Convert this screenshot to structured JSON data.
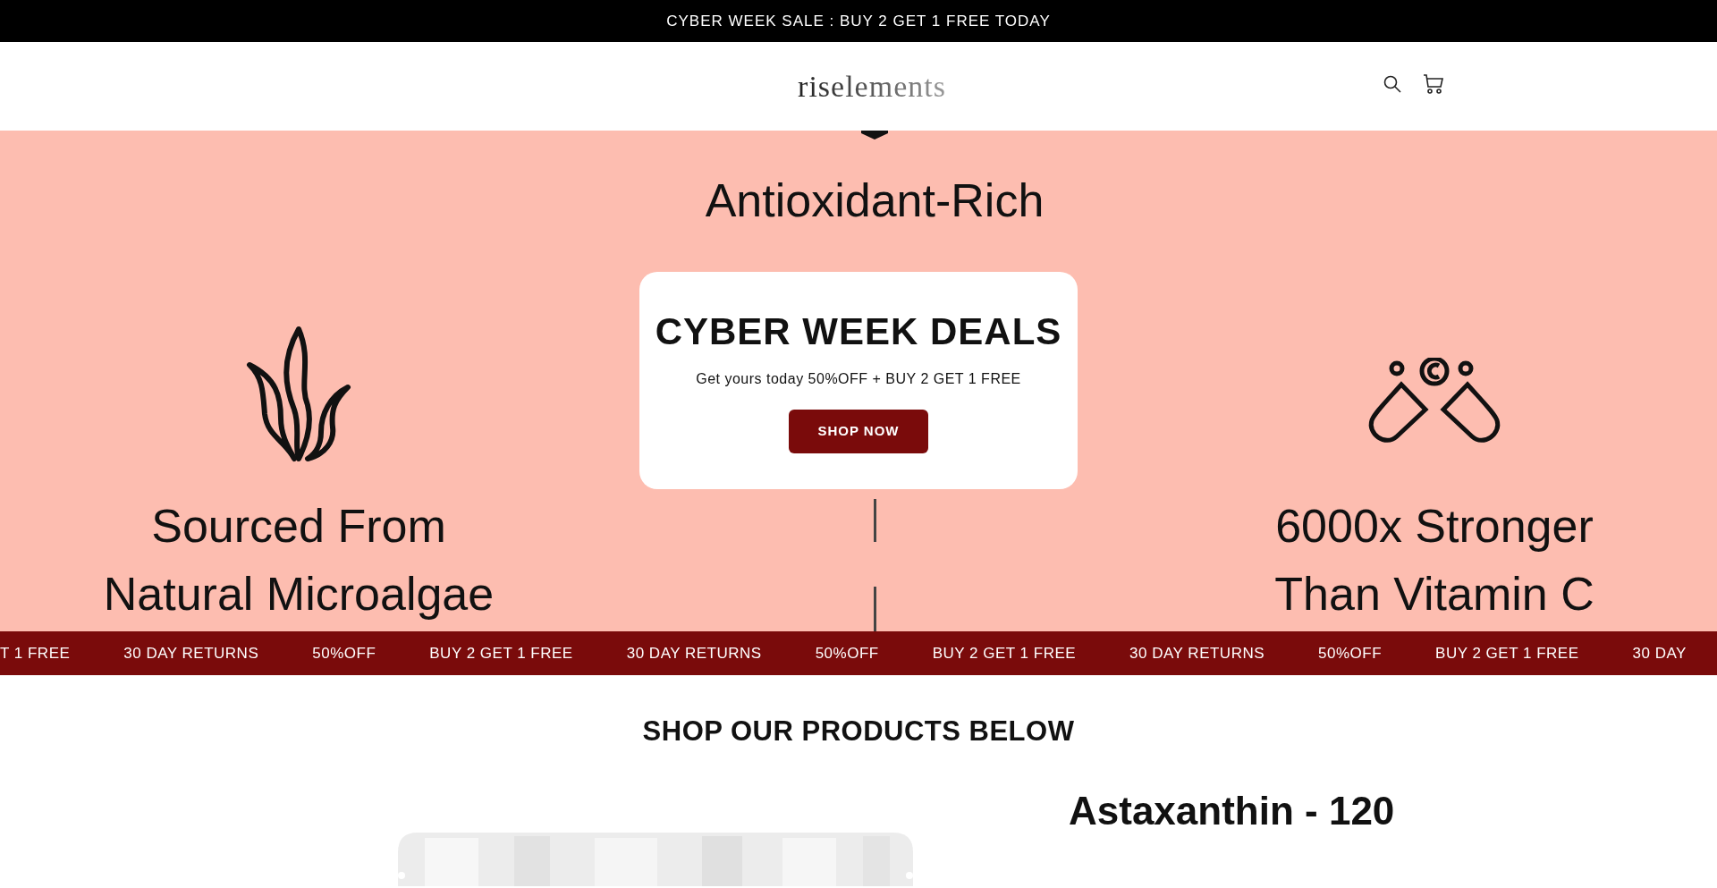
{
  "announcement": "CYBER WEEK SALE : BUY 2 GET 1 FREE TODAY",
  "header": {
    "logo": "riselements"
  },
  "hero": {
    "columns": [
      {
        "kind": "algae",
        "lines": [
          "Sourced From",
          "Natural Microalgae"
        ]
      },
      {
        "kind": "divider",
        "lines": [
          "Antioxidant-Rich"
        ]
      },
      {
        "kind": "capsules",
        "lines": [
          "6000x Stronger",
          "Than Vitamin C"
        ]
      }
    ],
    "popup": {
      "title": "CYBER WEEK DEALS",
      "text": "Get yours today 50%OFF + BUY 2 GET 1 FREE",
      "button": "SHOP NOW"
    }
  },
  "marquee": [
    "T 1 FREE",
    "30 DAY RETURNS",
    "50%OFF",
    "BUY 2 GET 1 FREE",
    "30 DAY RETURNS",
    "50%OFF",
    "BUY 2 GET 1 FREE",
    "30 DAY RETURNS",
    "50%OFF",
    "BUY 2 GET 1 FREE",
    "30 DAY"
  ],
  "products": {
    "heading": "SHOP OUR PRODUCTS BELOW",
    "items": [
      {
        "title": "Astaxanthin - 120"
      }
    ]
  }
}
